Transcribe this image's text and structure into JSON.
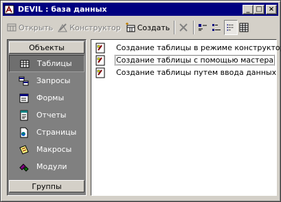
{
  "window": {
    "title": "DEVIL : база данных"
  },
  "controls": {
    "minimize": "_",
    "maximize": "□",
    "close": "×"
  },
  "toolbar": {
    "open": "Открыть",
    "design": "Конструктор",
    "create": "Создать"
  },
  "sidebar": {
    "header": "Объекты",
    "items": [
      {
        "label": "Таблицы",
        "icon": "table-icon"
      },
      {
        "label": "Запросы",
        "icon": "query-icon"
      },
      {
        "label": "Формы",
        "icon": "form-icon"
      },
      {
        "label": "Отчеты",
        "icon": "report-icon"
      },
      {
        "label": "Страницы",
        "icon": "page-icon"
      },
      {
        "label": "Макросы",
        "icon": "macro-icon"
      },
      {
        "label": "Модули",
        "icon": "module-icon"
      }
    ],
    "groups": "Группы"
  },
  "content": {
    "items": [
      "Создание таблицы в режиме конструктора",
      "Создание таблицы с помощью мастера",
      "Создание таблицы путем ввода данных"
    ]
  }
}
